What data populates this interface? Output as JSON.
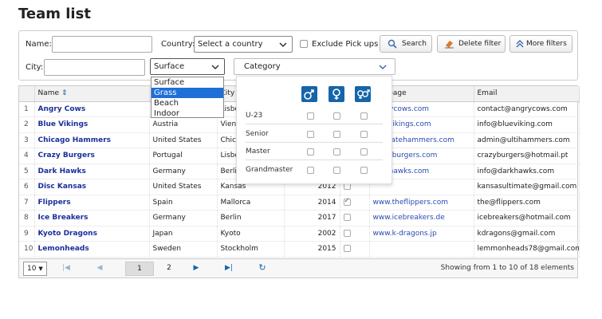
{
  "page": {
    "title": "Team list"
  },
  "filters": {
    "name_label": "Name:",
    "name_value": "",
    "country_label": "Country:",
    "country_value": "Select a country",
    "exclude_label": "Exclude Pick ups",
    "search_label": "Search",
    "delete_label": "Delete filter",
    "more_label": "More filters",
    "city_label": "City:",
    "city_value": "",
    "surface_value": "Surface",
    "category_value": "Category"
  },
  "surface_options": [
    "Surface",
    "Grass",
    "Beach",
    "Indoor"
  ],
  "surface_highlighted": "Grass",
  "category_panel": {
    "gender_icons": [
      "male-icon",
      "female-icon",
      "mixed-gender-icon"
    ],
    "rows": [
      "U-23",
      "Senior",
      "Master",
      "Grandmaster"
    ]
  },
  "table": {
    "headers": [
      "",
      "Name",
      "",
      "City",
      "",
      "",
      "Webpage",
      "Email"
    ],
    "rows": [
      {
        "n": "1",
        "name": "Angry Cows",
        "country": "",
        "city": "Lisbo",
        "year": "",
        "pickup": false,
        "web": "angrycows.com",
        "email": "contact@angrycows.com"
      },
      {
        "n": "2",
        "name": "Blue Vikings",
        "country": "Austria",
        "city": "Vien",
        "year": "",
        "pickup": false,
        "web": "bluevikings.com",
        "email": "info@blueviking.com"
      },
      {
        "n": "3",
        "name": "Chicago Hammers",
        "country": "United States",
        "city": "Chica",
        "year": "",
        "pickup": false,
        "web": "ultimatehammers.com",
        "email": "admin@ultihammers.com"
      },
      {
        "n": "4",
        "name": "Crazy Burgers",
        "country": "Portugal",
        "city": "Lisbo",
        "year": "",
        "pickup": false,
        "web": "crazyburgers.com",
        "email": "crazyburgers@hotmail.pt"
      },
      {
        "n": "5",
        "name": "Dark Hawks",
        "country": "Germany",
        "city": "Berli",
        "year": "",
        "pickup": false,
        "web": "darkhawks.com",
        "email": "info@darkhawks.com"
      },
      {
        "n": "6",
        "name": "Disc Kansas",
        "country": "United States",
        "city": "Kansas",
        "year": "2012",
        "pickup": false,
        "web": "",
        "email": "kansasultimate@gmail.com"
      },
      {
        "n": "7",
        "name": "Flippers",
        "country": "Spain",
        "city": "Mallorca",
        "year": "2014",
        "pickup": true,
        "web": "www.theflippers.com",
        "email": "the@flippers.com"
      },
      {
        "n": "8",
        "name": "Ice Breakers",
        "country": "Germany",
        "city": "Berlin",
        "year": "2017",
        "pickup": false,
        "web": "www.icebreakers.de",
        "email": "icebreakers@hotmail.com"
      },
      {
        "n": "9",
        "name": "Kyoto Dragons",
        "country": "Japan",
        "city": "Kyoto",
        "year": "2002",
        "pickup": false,
        "web": "www.k-dragons.jp",
        "email": "kdragons@gmail.com"
      },
      {
        "n": "10",
        "name": "Lemonheads",
        "country": "Sweden",
        "city": "Stockholm",
        "year": "2015",
        "pickup": false,
        "web": "",
        "email": "lemmonheads78@gmail.com"
      }
    ]
  },
  "pager": {
    "page_size": "10",
    "pages": [
      "1",
      "2"
    ],
    "current_page": "1",
    "status": "Showing from 1 to 10 of 18 elements"
  },
  "colors": {
    "accent": "#1565a8",
    "link": "#2a4bb0",
    "team": "#1a2f9a",
    "highlight": "#1e6fd8"
  }
}
